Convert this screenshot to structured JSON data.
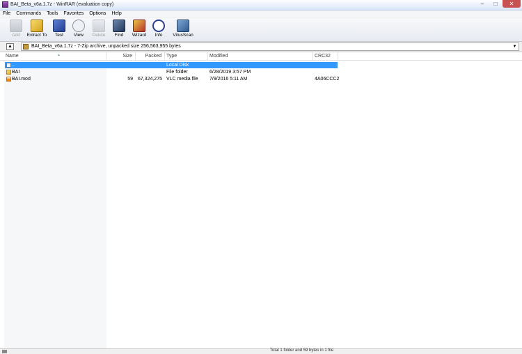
{
  "window": {
    "title": "BAI_Beta_v6a.1.7z - WinRAR (evaluation copy)",
    "controls": [
      "–",
      "□",
      "✕"
    ]
  },
  "menu": [
    "File",
    "Commands",
    "Tools",
    "Favorites",
    "Options",
    "Help"
  ],
  "toolbar": {
    "buttons": [
      {
        "label": "Add",
        "icon": "add-archive-icon",
        "enabled": false,
        "color": "#9aa4b0"
      },
      {
        "label": "Extract To",
        "icon": "extract-to-icon",
        "enabled": true,
        "color": "#e8c23a"
      },
      {
        "label": "Test",
        "icon": "test-icon",
        "enabled": true,
        "color": "#3c5db8"
      },
      {
        "label": "View",
        "icon": "view-icon",
        "enabled": true,
        "color": "#d8dde6"
      },
      {
        "label": "Delete",
        "icon": "delete-icon",
        "enabled": false,
        "color": "#b0b6be"
      },
      {
        "label": "Find",
        "icon": "find-icon",
        "enabled": true,
        "color": "#2f4f7a"
      },
      {
        "label": "Wizard",
        "icon": "wizard-icon",
        "enabled": true,
        "color": "#c0392b"
      },
      {
        "label": "Info",
        "icon": "info-icon",
        "enabled": true,
        "color": "#2c3e8f"
      },
      {
        "label": "VirusScan",
        "icon": "virusscan-icon",
        "enabled": true,
        "color": "#3a6ea5"
      }
    ]
  },
  "pathbar": {
    "up_symbol": "▲",
    "text": "BAI_Beta_v6a.1.7z - 7-Zip archive, unpacked size 256,563,955 bytes",
    "dropdown": "▼"
  },
  "columns": {
    "name": "Name",
    "size": "Size",
    "packed": "Packed",
    "type": "Type",
    "modified": "Modified",
    "crc": "CRC32"
  },
  "rows": [
    {
      "name": "..",
      "size": "",
      "packed": "",
      "type": "Local Disk",
      "modified": "",
      "crc": "",
      "icon": "up-folder-icon",
      "selected": true
    },
    {
      "name": "BAI",
      "size": "",
      "packed": "",
      "type": "File folder",
      "modified": "6/28/2019 3:57 PM",
      "crc": "",
      "icon": "folder-icon",
      "selected": false
    },
    {
      "name": "BAI.mod",
      "size": "59",
      "packed": "67,324,275",
      "type": "VLC media file",
      "modified": "7/9/2016 5:11 AM",
      "crc": "4A06CCC2",
      "icon": "vlc-file-icon",
      "selected": false
    }
  ],
  "status": {
    "text": "Total 1 folder and 59 bytes in 1 file"
  }
}
